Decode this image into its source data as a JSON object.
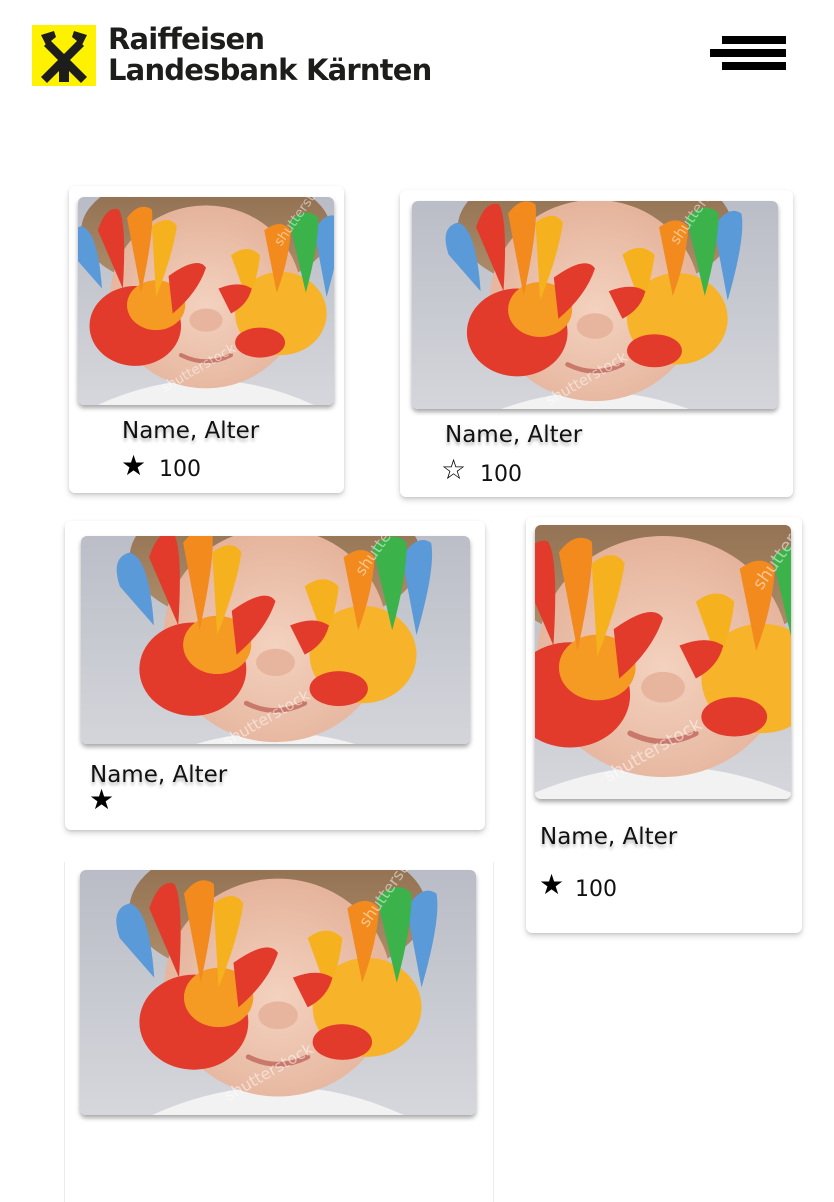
{
  "header": {
    "logo": {
      "line1": "Raiffeisen",
      "line2": "Landesbank Kärnten",
      "icon": "raiffeisen-crossed-horse-heads-icon",
      "brand_yellow": "#fff200",
      "brand_dark": "#1d1d1b"
    },
    "menu_icon": "hamburger-menu-icon"
  },
  "cards": [
    {
      "name": "Name, Alter",
      "star": "★",
      "star_state": "filled",
      "score": "100",
      "photo": "child-painted-hands-photo"
    },
    {
      "name": "Name, Alter",
      "star": "☆",
      "star_state": "outline",
      "score": "100",
      "photo": "child-painted-hands-photo"
    },
    {
      "name": "Name, Alter",
      "star": "★",
      "star_state": "filled",
      "photo": "child-painted-hands-photo"
    },
    {
      "name": "Name, Alter",
      "star": "★",
      "star_state": "filled",
      "score": "100",
      "photo": "child-painted-hands-photo"
    },
    {
      "photo": "child-painted-hands-photo"
    }
  ]
}
